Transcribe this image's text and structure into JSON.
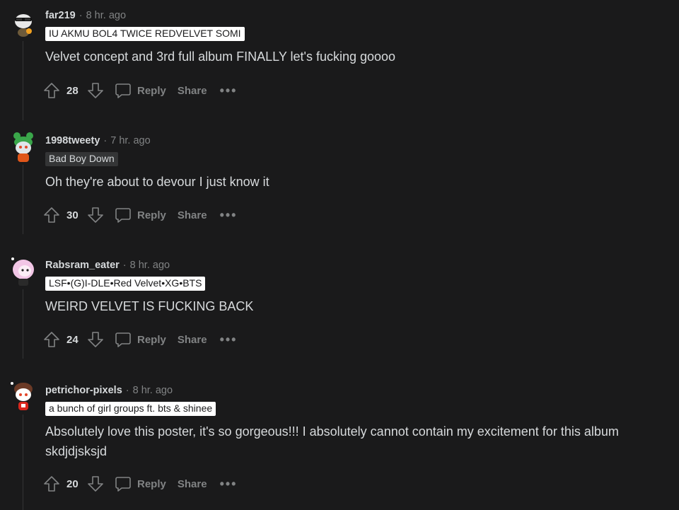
{
  "comments": [
    {
      "username": "far219",
      "time": "8 hr. ago",
      "flair": "IU AKMU BOL4 TWICE REDVELVET SOMI",
      "flair_style": "light",
      "body": "Velvet concept and 3rd full album FINALLY let's fucking goooo",
      "score": "28"
    },
    {
      "username": "1998tweety",
      "time": "7 hr. ago",
      "flair": "Bad Boy Down",
      "flair_style": "dark",
      "body": "Oh they're about to devour I just know it",
      "score": "30"
    },
    {
      "username": "Rabsram_eater",
      "time": "8 hr. ago",
      "flair": "LSF•(G)I-DLE•Red Velvet•XG•BTS",
      "flair_style": "light",
      "body": "WEIRD VELVET IS FUCKING BACK",
      "score": "24"
    },
    {
      "username": "petrichor-pixels",
      "time": "8 hr. ago",
      "flair": "a bunch of girl groups ft. bts & shinee",
      "flair_style": "light",
      "body": "Absolutely love this poster, it's so gorgeous!!! I absolutely cannot contain my excitement for this album skdjdjsksjd",
      "score": "20"
    }
  ],
  "actions": {
    "separator": "·",
    "reply": "Reply",
    "share": "Share",
    "more": "•••"
  },
  "icons": {
    "upvote": "arrow-up-outline-icon",
    "downvote": "arrow-down-outline-icon",
    "reply": "speech-bubble-icon",
    "more": "ellipsis-icon"
  },
  "colors": {
    "background": "#1a1a1b",
    "text": "#d7dadc",
    "muted": "#818384",
    "flair_light_bg": "#ffffff",
    "flair_dark_bg": "#343536"
  }
}
